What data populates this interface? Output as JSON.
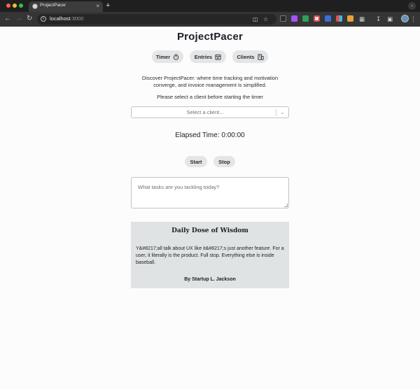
{
  "browser": {
    "tab_title": "ProjectPacer",
    "tab_close": "×",
    "new_tab": "+",
    "profile_menu": "⌄",
    "url_host": "localhost",
    "url_port": ":3000"
  },
  "app": {
    "title": "ProjectPacer",
    "nav": [
      {
        "label": "Timer",
        "icon": "timer-icon"
      },
      {
        "label": "Entries",
        "icon": "entries-icon"
      },
      {
        "label": "Clients",
        "icon": "clients-icon"
      }
    ],
    "intro": "Discover ProjectPacer: where time tracking and motivation converge, and invoice management is simplified.",
    "select_hint": "Please select a client before starting the timer",
    "client_select_placeholder": "Select a client...",
    "elapsed_label": "Elapsed Time: 0:00:00",
    "start_label": "Start",
    "stop_label": "Stop",
    "tasks_placeholder": "What tasks are you tackling today?"
  },
  "quote": {
    "heading": "Daily Dose of Wisdom",
    "text": "Y&#8217;all talk about UX like it&#8217;s just another feature. For a user, it literally is the product. Full stop. Everything else is inside baseball.",
    "author": "By Startup L. Jackson"
  },
  "colors": {
    "pill_bg": "#e3e5e6",
    "card_bg": "#dfe3e3",
    "page_bg": "#fcfcfd"
  }
}
